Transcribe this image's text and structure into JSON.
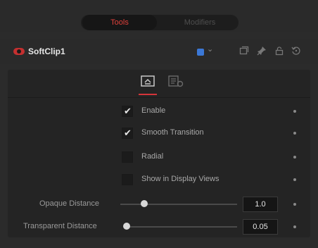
{
  "tabs": {
    "tools": "Tools",
    "modifiers": "Modifiers"
  },
  "tool": {
    "name": "SoftClip1",
    "node_color": "#c43030",
    "color_chip": "#3b78d6",
    "header_icons": [
      "version-icon",
      "pin-icon",
      "lock-icon",
      "reset-icon"
    ]
  },
  "subtabs": [
    "controls-tab-icon",
    "settings-tab-icon"
  ],
  "controls": {
    "checkboxes": [
      {
        "label": "Enable",
        "checked": true
      },
      {
        "label": "Smooth Transition",
        "checked": true
      },
      {
        "label": "Radial",
        "checked": false
      },
      {
        "label": "Show in Display Views",
        "checked": false
      }
    ],
    "sliders": [
      {
        "label": "Opaque Distance",
        "value": "1.0"
      },
      {
        "label": "Transparent Distance",
        "value": "0.05"
      }
    ]
  },
  "colors": {
    "accent": "#d4343a",
    "panel": "#2b2b2b",
    "field": "#151515"
  }
}
